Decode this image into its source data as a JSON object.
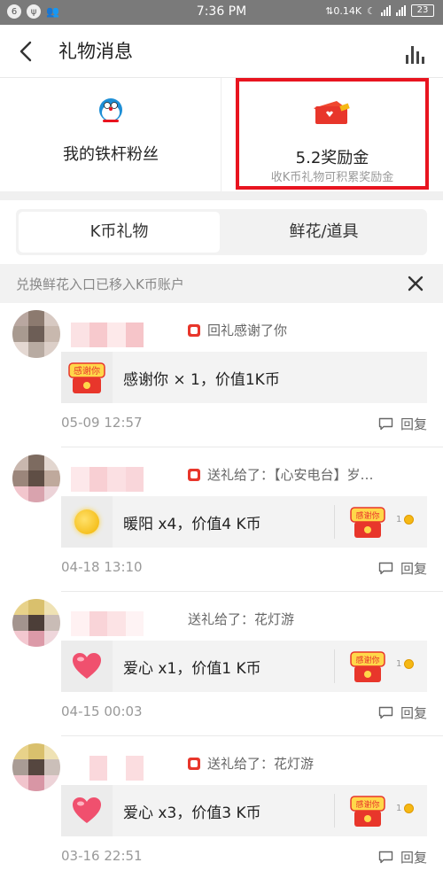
{
  "status_bar": {
    "left_badge": "6",
    "time": "7:36 PM",
    "net_speed": "0.14K",
    "battery": "23"
  },
  "header": {
    "title": "礼物消息"
  },
  "cards": {
    "fans_label": "我的铁杆粉丝",
    "bonus_label": "5.2奖励金",
    "bonus_sub": "收K币礼物可积累奖励金"
  },
  "tabs": [
    {
      "label": "K币礼物",
      "active": true
    },
    {
      "label": "鲜花/道具",
      "active": false
    }
  ],
  "notice": {
    "text": "兑换鲜花入口已移入K币账户"
  },
  "messages": [
    {
      "action": "回礼感谢了你",
      "gift_icon": "thanks-gift-icon",
      "gift_text": "感谢你 × 1，价值1K币",
      "return_gift": false,
      "time": "05-09 12:57",
      "reply_label": "回复"
    },
    {
      "action": "送礼给了：【心安电台】岁…",
      "gift_icon": "sun-gift-icon",
      "gift_text": "暖阳 x4，价值4 K币",
      "return_gift": true,
      "return_count": "1",
      "time": "04-18 13:10",
      "reply_label": "回复"
    },
    {
      "action": "送礼给了：花灯游",
      "gift_icon": "heart-gift-icon",
      "gift_text": "爱心 x1，价值1 K币",
      "return_gift": true,
      "return_count": "1",
      "time": "04-15 00:03",
      "reply_label": "回复"
    },
    {
      "action": "送礼给了：花灯游",
      "gift_icon": "heart-gift-icon",
      "gift_text": "爱心 x3，价值3 K币",
      "return_gift": true,
      "return_count": "1",
      "time": "03-16 22:51",
      "reply_label": "回复"
    }
  ],
  "colors": {
    "highlight_border": "#e8141f",
    "coin": "#f5b814",
    "heart": "#f0506e"
  }
}
